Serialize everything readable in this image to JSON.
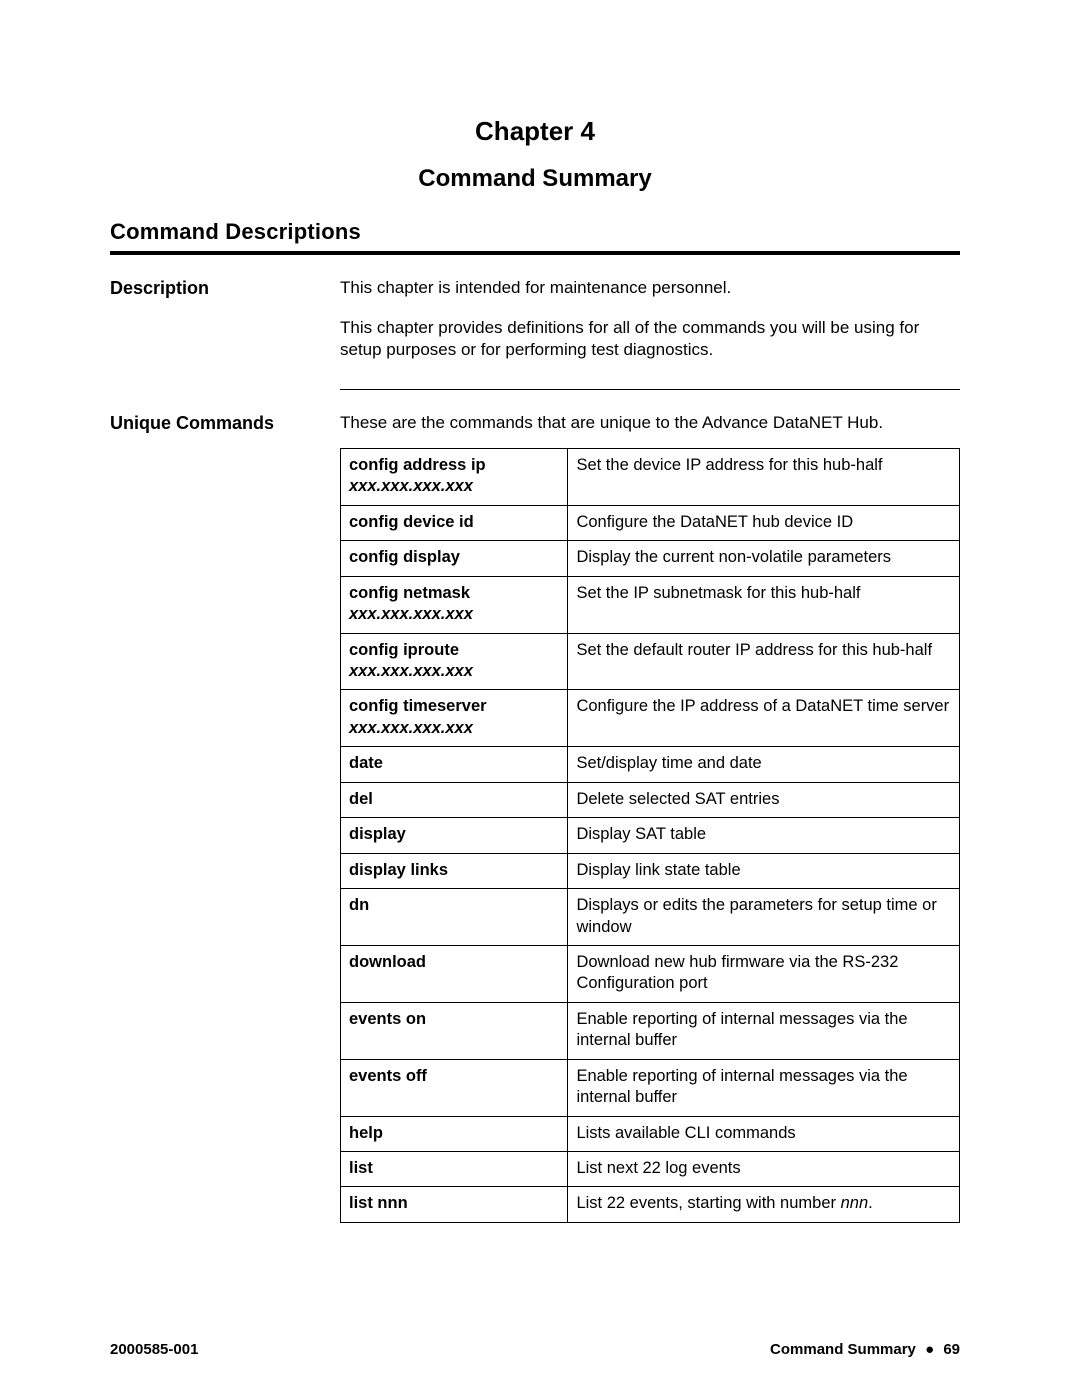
{
  "chapter": "Chapter 4",
  "subtitle": "Command Summary",
  "h1": "Command Descriptions",
  "desc": {
    "label": "Description",
    "p1": "This chapter is intended for maintenance personnel.",
    "p2": "This chapter provides definitions for all of the commands you will be using for setup purposes or for performing test diagnostics."
  },
  "unique": {
    "label": "Unique Commands",
    "intro": "These are the commands that are unique to the Advance DataNET Hub.",
    "rows": [
      {
        "cmd": "config address ip",
        "arg": "xxx.xxx.xxx.xxx",
        "desc": "Set the device IP address for this hub-half"
      },
      {
        "cmd": "config device id",
        "arg": "",
        "desc": "Configure the DataNET hub device ID"
      },
      {
        "cmd": "config display",
        "arg": "",
        "desc": "Display the current non-volatile parameters"
      },
      {
        "cmd": "config netmask",
        "arg": "xxx.xxx.xxx.xxx",
        "desc": "Set the IP subnetmask for this hub-half"
      },
      {
        "cmd": "config iproute",
        "arg": "xxx.xxx.xxx.xxx",
        "desc": "Set the default router IP address for this hub-half"
      },
      {
        "cmd": "config timeserver",
        "arg": "xxx.xxx.xxx.xxx",
        "desc": "Configure the IP address of a DataNET time server"
      },
      {
        "cmd": "date",
        "arg": "",
        "desc": "Set/display time and date"
      },
      {
        "cmd": "del",
        "arg": "",
        "desc": "Delete selected SAT entries"
      },
      {
        "cmd": "display",
        "arg": "",
        "desc": "Display SAT table"
      },
      {
        "cmd": "display links",
        "arg": "",
        "desc": "Display link state table"
      },
      {
        "cmd": "dn",
        "arg": "",
        "desc": "Displays or edits the parameters for setup time or window"
      },
      {
        "cmd": "download",
        "arg": "",
        "desc": "Download new hub firmware via the RS-232 Configuration port"
      },
      {
        "cmd": "events on",
        "arg": "",
        "desc": "Enable reporting of internal messages via the internal buffer"
      },
      {
        "cmd": "events off",
        "arg": "",
        "desc": "Enable reporting of internal messages via the internal buffer"
      },
      {
        "cmd": "help",
        "arg": "",
        "desc": "Lists available CLI commands"
      },
      {
        "cmd": "list",
        "arg": "",
        "desc": "List next 22 log events"
      },
      {
        "cmd": "list nnn",
        "arg": "",
        "desc_pre": "List 22 events, starting with number ",
        "desc_em": "nnn",
        "desc_post": "."
      }
    ]
  },
  "footer": {
    "left": "2000585-001",
    "right_title": "Command Summary",
    "right_page": "69"
  }
}
